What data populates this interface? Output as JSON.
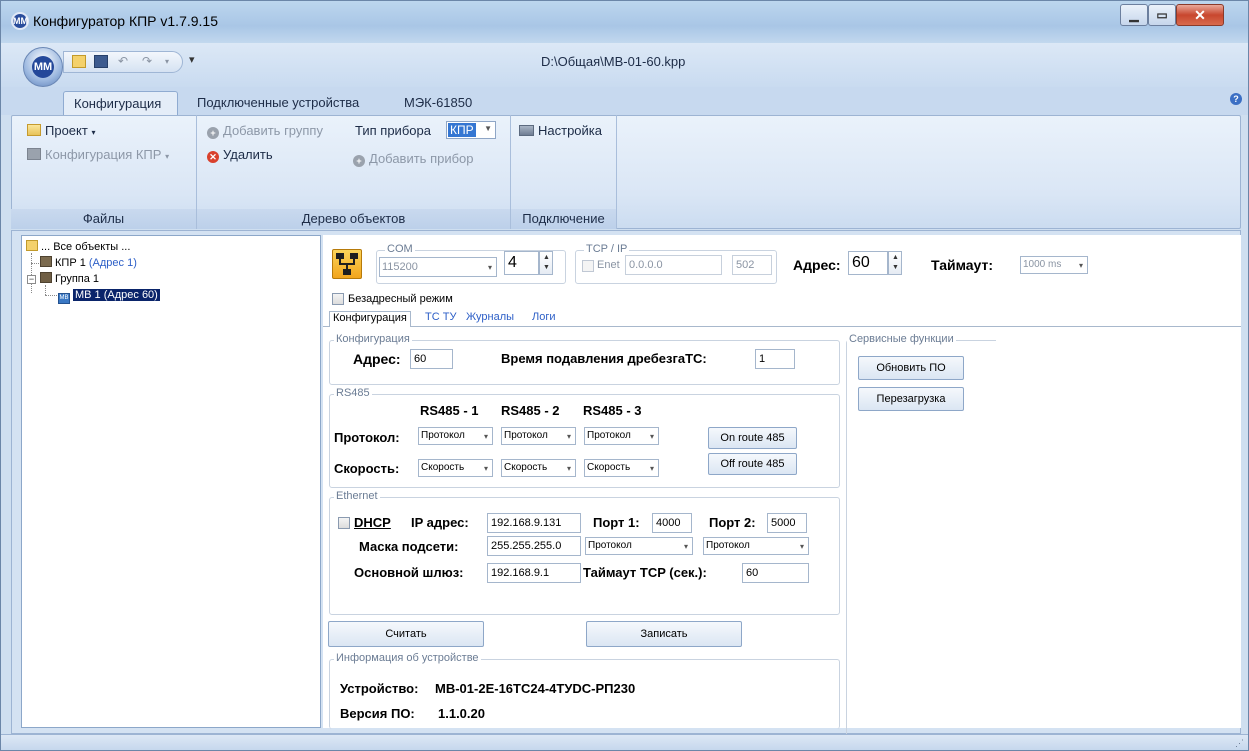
{
  "window": {
    "title": "Конфигуратор КПР v1.7.9.15",
    "doc_path": "D:\\Общая\\МВ-01-60.kpp",
    "app_icon": "MM"
  },
  "ribbon": {
    "tabs": [
      "Конфигурация",
      "Подключенные устройства",
      "МЭК-61850"
    ],
    "help": "?",
    "files": {
      "project": "Проект",
      "config_kpr": "Конфигурация КПР",
      "label": "Файлы"
    },
    "tree_group": {
      "add_group": "Добавить группу",
      "device_type_label": "Тип прибора",
      "device_type_value": "КПР",
      "delete": "Удалить",
      "add_device": "Добавить прибор",
      "label": "Дерево объектов"
    },
    "connection": {
      "settings": "Настройка",
      "label": "Подключение"
    }
  },
  "tree": {
    "root": "... Все объекты ...",
    "kpr": "КПР 1",
    "kpr_addr": "(Адрес 1)",
    "group": "Группа 1",
    "mv_badge": "MB",
    "mv": "МВ 1 (Адрес 60)"
  },
  "conn": {
    "com_label": "COM",
    "baud": "115200",
    "com_port": "4",
    "tcp_label": "TCP / IP",
    "enet": "Enet",
    "ip": "0.0.0.0",
    "port": "502",
    "address_label": "Адрес:",
    "address": "60",
    "timeout_label": "Таймаут:",
    "timeout": "1000 ms",
    "addressless": "Безадресный режим"
  },
  "tabs": [
    "Конфигурация",
    "ТС ТУ",
    "Журналы",
    "Логи"
  ],
  "config": {
    "legend": "Конфигурация",
    "addr_label": "Адрес:",
    "addr": "60",
    "debounce_label": "Время подавления дребезгаТС:",
    "debounce": "1"
  },
  "rs485": {
    "legend": "RS485",
    "headers": [
      "RS485 - 1",
      "RS485 - 2",
      "RS485 - 3"
    ],
    "protocol_label": "Протокол:",
    "speed_label": "Скорость:",
    "protocol_values": [
      "Протокол",
      "Протокол",
      "Протокол"
    ],
    "speed_values": [
      "Скорость",
      "Скорость",
      "Скорость"
    ],
    "on_route": "On route 485",
    "off_route": "Off route 485"
  },
  "ethernet": {
    "legend": "Ethernet",
    "dhcp": "DHCP",
    "ip_label": "IP адрес:",
    "ip": "192.168.9.131",
    "port1_label": "Порт 1:",
    "port1": "4000",
    "port2_label": "Порт 2:",
    "port2": "5000",
    "mask_label": "Маска подсети:",
    "mask": "255.255.255.0",
    "proto1": "Протокол",
    "proto2": "Протокол",
    "gateway_label": "Основной шлюз:",
    "gateway": "192.168.9.1",
    "tcp_timeout_label": "Таймаут TCP (сек.):",
    "tcp_timeout": "60"
  },
  "actions": {
    "read": "Считать",
    "write": "Записать"
  },
  "device_info": {
    "legend": "Информация об устройстве",
    "device_label": "Устройство:",
    "device": "МВ-01-2Е-16ТС24-4ТУDC-РП230",
    "fw_label": "Версия ПО:",
    "fw": "1.1.0.20"
  },
  "service": {
    "legend": "Сервисные функции",
    "update_fw": "Обновить ПО",
    "reboot": "Перезагрузка"
  }
}
